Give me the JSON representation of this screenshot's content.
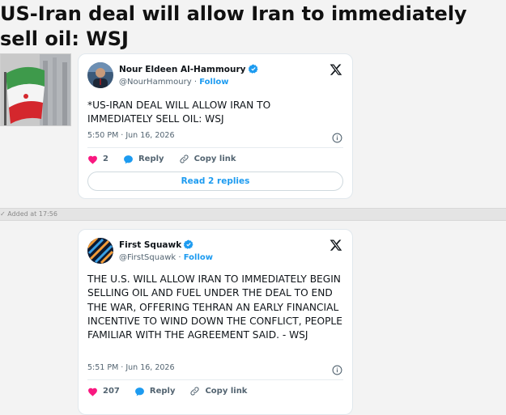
{
  "headline": "US-Iran deal will allow Iran to immediately sell oil: WSJ",
  "added_label": "Added at 17:56",
  "tweets": [
    {
      "name": "Nour Eldeen Al-Hammoury",
      "handle": "@NourHammoury",
      "follow_label": "Follow",
      "text": "*US-IRAN DEAL WILL ALLOW IRAN TO IMMEDIATELY SELL OIL: WSJ",
      "timestamp": "5:50 PM · Jun 16, 2026",
      "likes": "2",
      "reply_label": "Reply",
      "copy_label": "Copy link",
      "replies_button": "Read 2 replies"
    },
    {
      "name": "First Squawk",
      "handle": "@FirstSquawk",
      "follow_label": "Follow",
      "text": "THE U.S. WILL ALLOW IRAN TO IMMEDIATELY BEGIN SELLING OIL AND FUEL UNDER THE DEAL TO END THE WAR, OFFERING TEHRAN AN EARLY FINANCIAL INCENTIVE TO WIND DOWN THE CONFLICT, PEOPLE FAMILIAR WITH THE AGREEMENT SAID. - WSJ",
      "timestamp": "5:51 PM · Jun 16, 2026",
      "likes": "207",
      "reply_label": "Reply",
      "copy_label": "Copy link"
    }
  ],
  "colors": {
    "accent": "#1d9bf0",
    "heart": "#f91880",
    "text": "#0f1419",
    "muted": "#536471"
  },
  "icons": [
    "x-logo-icon",
    "verified-badge-icon",
    "info-icon",
    "heart-icon",
    "reply-bubble-icon",
    "link-icon",
    "chevron-down-icon"
  ]
}
